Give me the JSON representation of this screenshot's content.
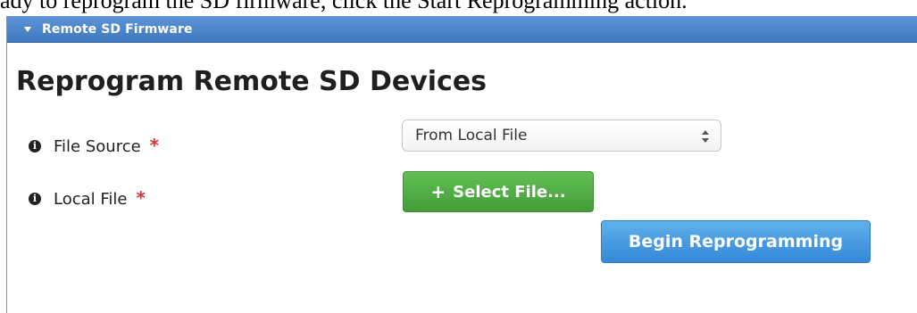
{
  "document": {
    "instruction_text": "ady to reprogram the SD firmware, click the Start Reprogramming action."
  },
  "panel": {
    "title": "Remote SD Firmware"
  },
  "page": {
    "title": "Reprogram Remote SD Devices"
  },
  "form": {
    "file_source": {
      "label": "File Source",
      "required_mark": "*",
      "selected_value": "From Local File"
    },
    "local_file": {
      "label": "Local File",
      "required_mark": "*",
      "button_icon": "+",
      "button_label": "Select File..."
    },
    "submit": {
      "label": "Begin Reprogramming"
    }
  },
  "icons": {
    "info": "i",
    "panel_caret": "caret-down-icon",
    "select_arrows": "updown-arrows-icon"
  },
  "colors": {
    "panel_header": "#4a82c7",
    "success_button": "#54ad46",
    "primary_button": "#459de2",
    "required": "#d33333"
  }
}
